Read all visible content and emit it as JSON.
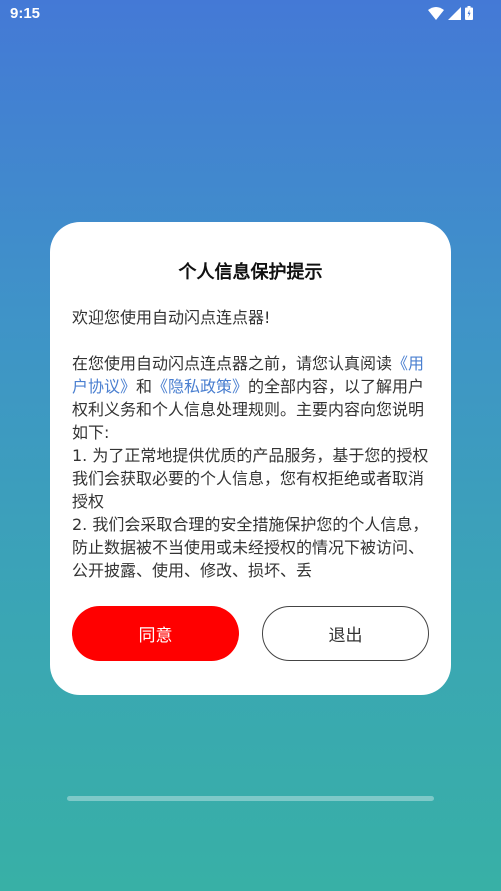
{
  "status_bar": {
    "time": "9:15"
  },
  "dialog": {
    "title": "个人信息保护提示",
    "welcome": "欢迎您使用自动闪点连点器!",
    "intro_1": "在您使用自动闪点连点器之前，请您认真阅读",
    "link_user_agreement": "《用户协议》",
    "and": "和",
    "link_privacy_policy": "《隐私政策》",
    "intro_2": "的全部内容，以了解用户权利义务和个人信息处理规则。主要内容向您说明如下:",
    "item_1": "1. 为了正常地提供优质的产品服务，基于您的授权我们会获取必要的个人信息，您有权拒绝或者取消授权",
    "item_2": "2. 我们会采取合理的安全措施保护您的个人信息，防止数据被不当使用或未经授权的情况下被访问、公开披露、使用、修改、损坏、丢",
    "agree_label": "同意",
    "exit_label": "退出"
  },
  "colors": {
    "agree_button": "#ff0000",
    "link": "#4a7fd0",
    "background_top": "#4479d6",
    "background_bottom": "#38b0a6"
  }
}
